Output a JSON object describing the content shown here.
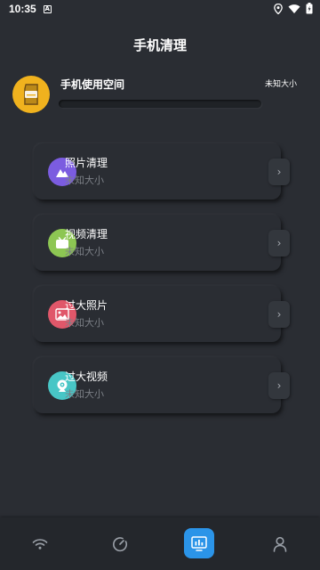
{
  "status_bar": {
    "time": "10:35",
    "a_badge": "A"
  },
  "header": {
    "title": "手机清理"
  },
  "storage": {
    "title": "手机使用空间",
    "value": "未知大小",
    "progress": 0,
    "icon": "sd-card-icon"
  },
  "cards": [
    {
      "title": "照片清理",
      "subtitle": "未知大小",
      "icon": "mountain-image-icon",
      "color": "#7b5ce0"
    },
    {
      "title": "视频清理",
      "subtitle": "未知大小",
      "icon": "video-icon",
      "color": "#8dc653"
    },
    {
      "title": "过大照片",
      "subtitle": "未知大小",
      "icon": "photo-icon",
      "color": "#e0576a"
    },
    {
      "title": "过大视频",
      "subtitle": "未知大小",
      "icon": "webcam-icon",
      "color": "#48c6c6"
    }
  ],
  "bottom_nav": [
    {
      "name": "wifi-icon",
      "active": false
    },
    {
      "name": "speedometer-icon",
      "active": false
    },
    {
      "name": "cleaner-icon",
      "active": true,
      "color": "#2b94e8"
    },
    {
      "name": "user-icon",
      "active": false
    }
  ],
  "arrow_glyph": "›"
}
